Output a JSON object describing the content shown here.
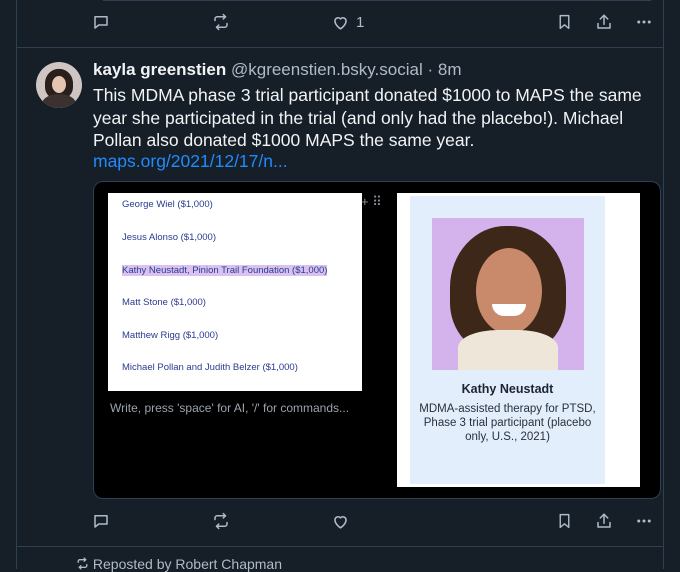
{
  "prev_post": {
    "like_count": "1"
  },
  "post": {
    "author": "kayla greenstien",
    "handle": "@kgreenstien.bsky.social",
    "separator": "·",
    "time": "8m",
    "text": "This MDMA phase 3 trial participant donated $1000 to MAPS the same year she participated in the trial (and only had the placebo!). Michael Pollan also donated $1000 MAPS the same year.",
    "link": "maps.org/2021/12/17/n..."
  },
  "media": {
    "donors": [
      "George Wiel ($1,000)",
      "Jesus Alonso ($1,000)",
      "Kathy Neustadt, Pinion Trail Foundation ($1,000)",
      "Matt Stone ($1,000)",
      "Matthew Rigg ($1,000)",
      "Michael Pollan and Judith Belzer ($1,000)"
    ],
    "editor_tools": "+ ⠿",
    "editor_placeholder": "Write, press 'space' for AI, '/' for commands...",
    "card_name": "Kathy Neustadt",
    "card_desc": "MDMA-assisted therapy for PTSD, Phase 3 trial participant (placebo only, U.S., 2021)"
  },
  "repost_label": "Reposted by Robert Chapman",
  "icons": [
    "reply-icon",
    "repost-icon",
    "like-icon",
    "bookmark-icon",
    "share-icon",
    "more-icon",
    "repost-small-icon"
  ],
  "colors": {
    "background": "#161e27",
    "text": "#f1f3f5",
    "muted": "#aebbc9",
    "link": "#208bfe",
    "border": "#2e4052"
  }
}
